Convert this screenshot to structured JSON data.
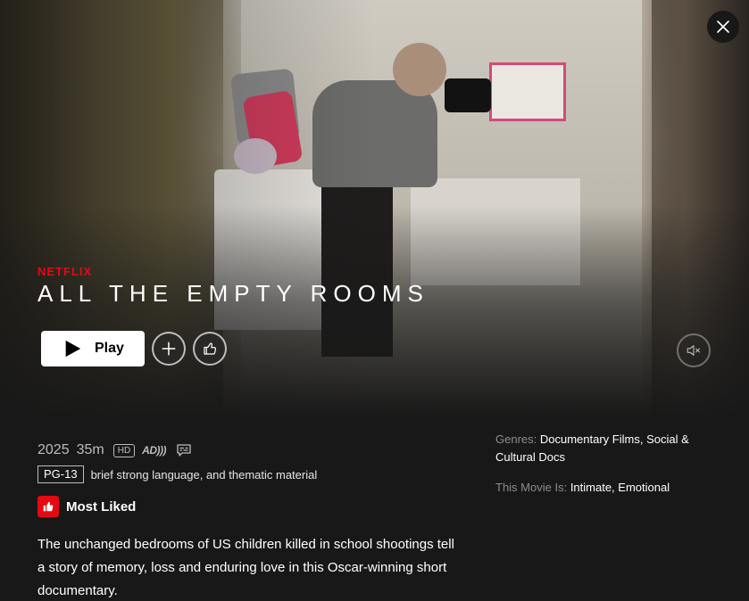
{
  "brand": "NETFLIX",
  "title": "ALL THE EMPTY ROOMS",
  "actions": {
    "play_label": "Play"
  },
  "meta": {
    "year": "2025",
    "runtime": "35m",
    "quality": "HD",
    "audio_description": "AD)))"
  },
  "rating": {
    "code": "PG-13",
    "reason": "brief strong language, and thematic material"
  },
  "badge": {
    "label": "Most Liked"
  },
  "synopsis": "The unchanged bedrooms of US children killed in school shootings tell a story of memory, loss and enduring love in this Oscar-winning short documentary.",
  "side": {
    "genres_label": "Genres:",
    "genres_value": "Documentary Films, Social & Cultural Docs",
    "moods_label": "This Movie Is:",
    "moods_value": "Intimate, Emotional"
  },
  "colors": {
    "brand_red": "#e50914",
    "background": "#181818"
  },
  "icons": [
    "close-icon",
    "play-icon",
    "plus-icon",
    "thumbs-up-icon",
    "mute-icon",
    "subtitles-icon"
  ]
}
